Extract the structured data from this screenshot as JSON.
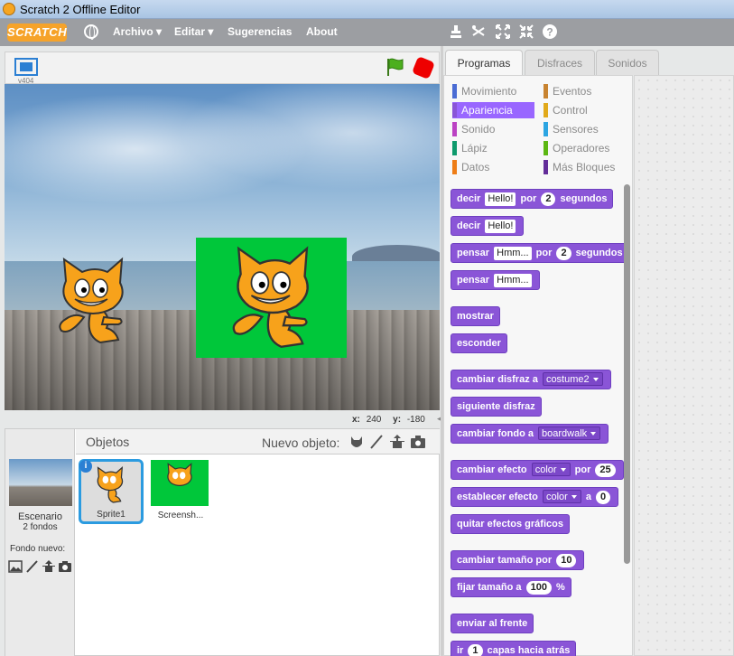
{
  "window": {
    "title": "Scratch 2 Offline Editor"
  },
  "menubar": {
    "logo": "SCRATCH",
    "items": [
      "Archivo",
      "Editar",
      "Sugerencias",
      "About"
    ],
    "archivo": "Archivo ▾",
    "editar": "Editar ▾",
    "sugerencias": "Sugerencias",
    "about": "About"
  },
  "stage": {
    "version": "v404"
  },
  "coords": {
    "x_label": "x:",
    "x": "240",
    "y_label": "y:",
    "y": "-180"
  },
  "sprites": {
    "header": "Objetos",
    "new_object": "Nuevo objeto:",
    "stage_label": "Escenario",
    "stage_count": "2 fondos",
    "new_backdrop": "Fondo nuevo:",
    "items": [
      {
        "name": "Sprite1",
        "selected": true
      },
      {
        "name": "Screensh..."
      }
    ]
  },
  "tabs": [
    "Programas",
    "Disfraces",
    "Sonidos"
  ],
  "categories": [
    {
      "label": "Movimiento",
      "color": "#4a6cd4"
    },
    {
      "label": "Eventos",
      "color": "#c88330"
    },
    {
      "label": "Apariencia",
      "color": "#8a55d7",
      "active": true
    },
    {
      "label": "Control",
      "color": "#e1a91a"
    },
    {
      "label": "Sonido",
      "color": "#bb42c3"
    },
    {
      "label": "Sensores",
      "color": "#2ca5e2"
    },
    {
      "label": "Lápiz",
      "color": "#0e9a6c"
    },
    {
      "label": "Operadores",
      "color": "#5cb712"
    },
    {
      "label": "Datos",
      "color": "#ee7d16"
    },
    {
      "label": "Más Bloques",
      "color": "#632d99"
    }
  ],
  "blocks": {
    "b1": {
      "a": "decir",
      "i1": "Hello!",
      "b": "por",
      "n1": "2",
      "c": "segundos"
    },
    "b2": {
      "a": "decir",
      "i1": "Hello!"
    },
    "b3": {
      "a": "pensar",
      "i1": "Hmm...",
      "b": "por",
      "n1": "2",
      "c": "segundos"
    },
    "b4": {
      "a": "pensar",
      "i1": "Hmm..."
    },
    "b5": {
      "a": "mostrar"
    },
    "b6": {
      "a": "esconder"
    },
    "b7": {
      "a": "cambiar disfraz a",
      "d1": "costume2"
    },
    "b8": {
      "a": "siguiente disfraz"
    },
    "b9": {
      "a": "cambiar fondo a",
      "d1": "boardwalk"
    },
    "b10": {
      "a": "cambiar efecto",
      "d1": "color",
      "b": "por",
      "n1": "25"
    },
    "b11": {
      "a": "establecer efecto",
      "d1": "color",
      "b": "a",
      "n1": "0"
    },
    "b12": {
      "a": "quitar efectos gráficos"
    },
    "b13": {
      "a": "cambiar tamaño por",
      "n1": "10"
    },
    "b14": {
      "a": "fijar tamaño a",
      "n1": "100",
      "c": "%"
    },
    "b15": {
      "a": "enviar al frente"
    },
    "b16": {
      "a": "ir",
      "n1": "1",
      "c": "capas hacia atrás"
    }
  }
}
